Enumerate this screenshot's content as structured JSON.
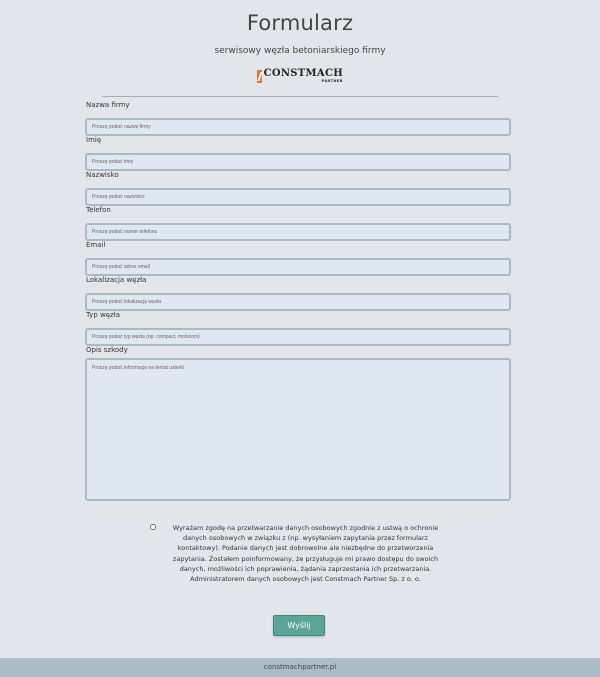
{
  "header": {
    "title": "Formularz",
    "subtitle": "serwisowy węzła betoniarskiego firmy",
    "logo_text": "CONSTMACH",
    "logo_subtext": "PARTNER"
  },
  "form": {
    "fields": [
      {
        "label": "Nazwa firmy",
        "placeholder": "Proszę podać nazwę firmy"
      },
      {
        "label": "Imię",
        "placeholder": "Proszę podać imię"
      },
      {
        "label": "Nazwisko",
        "placeholder": "Proszę podać nazwisko"
      },
      {
        "label": "Telefon",
        "placeholder": "Proszę podać numer telefonu"
      },
      {
        "label": "Email",
        "placeholder": "Proszę podać adres email"
      },
      {
        "label": "Lokalizacja węzła",
        "placeholder": "Proszę podać lokalizację węzła"
      },
      {
        "label": "Typ węzła",
        "placeholder": "Proszę podać typ węzła (np. compact, mobicom)"
      },
      {
        "label": "Opis szkody",
        "placeholder": "Proszę podać informację na temat usterki"
      }
    ],
    "consent_text": "Wyrażam zgodę na przetwarzanie danych osobowych zgodnie z ustwą o ochronie danych osobowych w związku z (np. wysyłaniem zapytania przez formularz kontaktowy). Podanie danych jest dobrowolne ale niezbędne do przetworzenia zapytania. Zostałem poinformowany, że przysługuje mi prawo dostępu do swoich danych, możliwości ich poprawienia, żądania zaprzestania ich przetwarzania. Administratorem danych osobowych jest Constmach Partner Sp. z o. o.",
    "submit_label": "Wyślij"
  },
  "footer": {
    "text": "constmachpartner.pl"
  }
}
